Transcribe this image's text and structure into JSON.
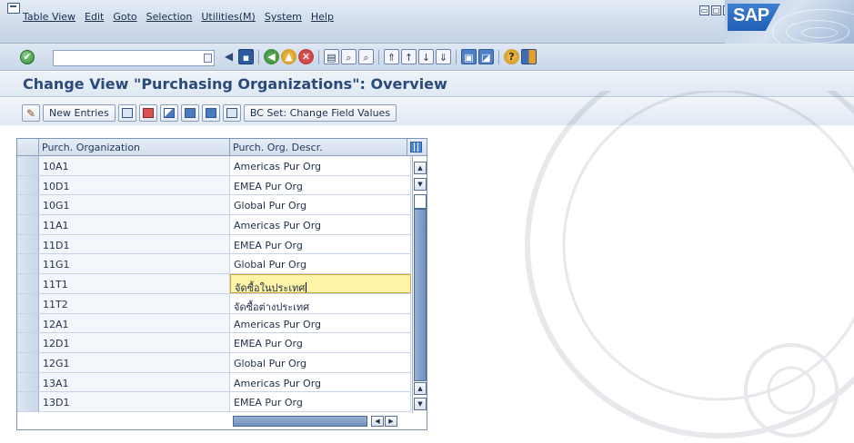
{
  "menu": {
    "items": [
      "Table View",
      "Edit",
      "Goto",
      "Selection",
      "Utilities(M)",
      "System",
      "Help"
    ]
  },
  "window_buttons": [
    "▭",
    "□",
    "✕"
  ],
  "logo": {
    "text": "SAP"
  },
  "toolbar": {
    "command_field_value": "",
    "icons": [
      "enter-icon",
      "back-nav-icon",
      "save-icon",
      "back-icon",
      "exit-icon",
      "cancel-icon",
      "print-icon",
      "find-icon",
      "find-next-icon",
      "first-page-icon",
      "previous-page-icon",
      "next-page-icon",
      "last-page-icon",
      "create-session-icon",
      "shortcut-icon",
      "help-icon",
      "layout-icon"
    ]
  },
  "page": {
    "title": "Change View \"Purchasing Organizations\": Overview"
  },
  "app_toolbar": {
    "new_entries_label": "New Entries",
    "bc_set_label": "BC Set: Change Field Values"
  },
  "table": {
    "columns": [
      "Purch. Organization",
      "Purch. Org. Descr."
    ],
    "rows": [
      {
        "org": "10A1",
        "descr": "Americas Pur Org"
      },
      {
        "org": "10D1",
        "descr": "EMEA Pur Org"
      },
      {
        "org": "10G1",
        "descr": "Global Pur Org"
      },
      {
        "org": "11A1",
        "descr": "Americas Pur Org"
      },
      {
        "org": "11D1",
        "descr": "EMEA Pur Org"
      },
      {
        "org": "11G1",
        "descr": "Global Pur Org"
      },
      {
        "org": "11T1",
        "descr": "จัดซื้อในประเทศ"
      },
      {
        "org": "11T2",
        "descr": "จัดซื้อต่างประเทศ"
      },
      {
        "org": "12A1",
        "descr": "Americas Pur Org"
      },
      {
        "org": "12D1",
        "descr": "EMEA Pur Org"
      },
      {
        "org": "12G1",
        "descr": "Global Pur Org"
      },
      {
        "org": "13A1",
        "descr": "Americas Pur Org"
      },
      {
        "org": "13D1",
        "descr": "EMEA Pur Org"
      }
    ],
    "active_row": 6
  },
  "colors": {
    "title": "#2a4a7a",
    "active_cell": "#fff3a8",
    "accent": "#2d5ba0"
  }
}
